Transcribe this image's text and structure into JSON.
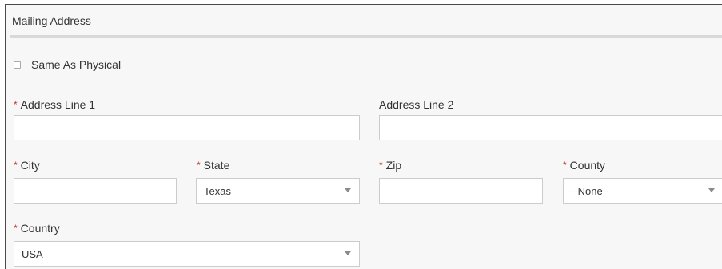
{
  "section": {
    "title": "Mailing Address"
  },
  "same_as_physical": {
    "label": "Same As Physical",
    "checked": false
  },
  "required_marker": "*",
  "fields": {
    "address_line_1": {
      "label": "Address Line 1",
      "value": ""
    },
    "address_line_2": {
      "label": "Address Line 2",
      "value": ""
    },
    "city": {
      "label": "City",
      "value": ""
    },
    "state": {
      "label": "State",
      "selected": "Texas"
    },
    "zip": {
      "label": "Zip",
      "value": ""
    },
    "county": {
      "label": "County",
      "selected": "--None--"
    },
    "country": {
      "label": "Country",
      "selected": "USA"
    }
  },
  "colors": {
    "required": "#c23934",
    "panel_bg": "#f7f7f7",
    "input_border": "#cccccc"
  }
}
